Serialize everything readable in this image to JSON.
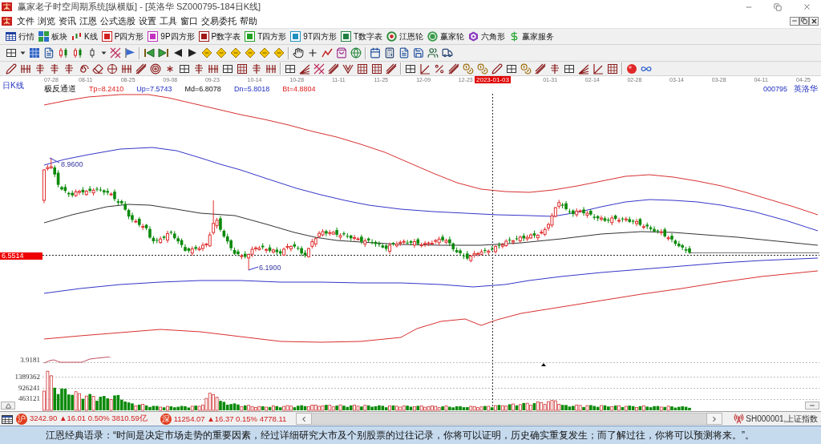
{
  "window": {
    "title": "赢家老子时空周期系统[纵横版] - [英洛华  SZ000795-184日K线]"
  },
  "menu": [
    "文件",
    "浏览",
    "资讯",
    "江恩",
    "公式选股",
    "设置",
    "工具",
    "窗口",
    "交易委托",
    "帮助"
  ],
  "toolbar": [
    {
      "label": "行情",
      "kind": "quotes"
    },
    {
      "label": "板块",
      "kind": "sectors"
    },
    {
      "label": "K线",
      "kind": "kline"
    },
    {
      "label": "P四方形",
      "kind": "square",
      "color": "#d02020"
    },
    {
      "label": "9P四方形",
      "kind": "square",
      "color": "#c030c0"
    },
    {
      "label": "P数字表",
      "kind": "square",
      "color": "#a01818"
    },
    {
      "label": "T四方形",
      "kind": "square",
      "color": "#20a020"
    },
    {
      "label": "9T四方形",
      "kind": "square",
      "color": "#2090c0"
    },
    {
      "label": "T数字表",
      "kind": "square",
      "color": "#208040"
    },
    {
      "label": "江恩轮",
      "kind": "target"
    },
    {
      "label": "赢家轮",
      "kind": "wheel"
    },
    {
      "label": "六角形",
      "kind": "hexagon"
    },
    {
      "label": "赢家服务",
      "kind": "service"
    }
  ],
  "chart": {
    "period": "日K线",
    "dates": [
      "07-28",
      "08-11",
      "08-25",
      "09-08",
      "09-23",
      "10-14",
      "10-28",
      "11-11",
      "11-25",
      "12-09",
      "12-23",
      "01-31",
      "02-14",
      "02-28",
      "03-14",
      "03-28",
      "04-11",
      "04-25"
    ],
    "cursor_date": "2023-01-03",
    "indicator": {
      "name": "极反通道",
      "values": [
        {
          "label": "Tp=8.2410",
          "kind": "outer"
        },
        {
          "label": "Up=7.5743",
          "kind": "inner"
        },
        {
          "label": "Md=6.8078",
          "kind": "middle"
        },
        {
          "label": "Dn=5.8018",
          "kind": "inner"
        },
        {
          "label": "Bt=4.8804",
          "kind": "outer"
        }
      ]
    },
    "code": "000795",
    "stock": "英洛华",
    "high_label": "8.9600",
    "low_label": "6.1900",
    "price_tag": "6.5514"
  },
  "volume": {
    "axis_labels": [
      "3.9181",
      "1389362",
      "926241",
      "463121"
    ]
  },
  "status_bar": {
    "indices": [
      {
        "badge": "沪",
        "quote": "3242.90 ▲16.01 0.50% 3810.59亿"
      },
      {
        "badge": "深",
        "quote": "11254.07 ▲16.37 0.15% 4778.11"
      }
    ],
    "market": "SH000001,上证指数"
  },
  "quote": "江恩经典语录：“时间是决定市场走势的重要因素，经过详细研究大市及个别股票的过往记录，你将可以证明，历史确实重复发生；而了解过往，你将可以预测将来。”。"
}
